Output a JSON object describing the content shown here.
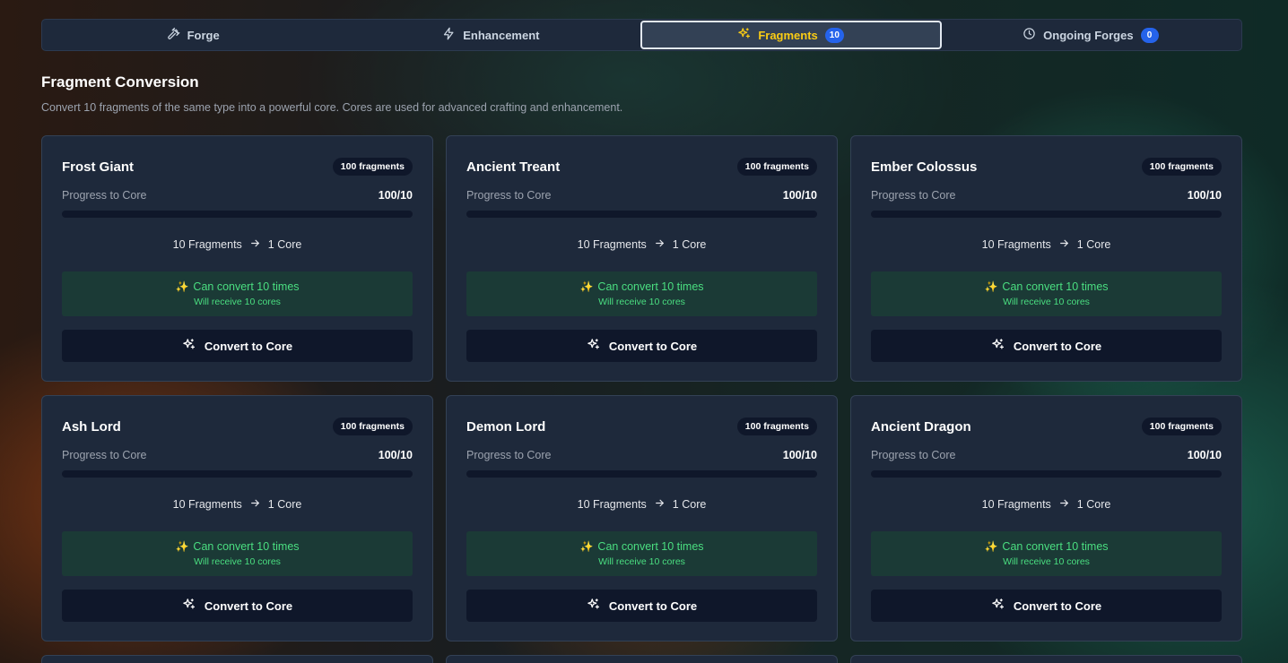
{
  "tabs": [
    {
      "label": "Forge",
      "icon": "hammer-icon",
      "active": false
    },
    {
      "label": "Enhancement",
      "icon": "bolt-icon",
      "active": false
    },
    {
      "label": "Fragments",
      "icon": "sparkles-icon",
      "active": true,
      "badge": "10"
    },
    {
      "label": "Ongoing Forges",
      "icon": "clock-icon",
      "active": false,
      "badge": "0"
    }
  ],
  "section": {
    "title": "Fragment Conversion",
    "description": "Convert 10 fragments of the same type into a powerful core. Cores are used for advanced crafting and enhancement."
  },
  "colors": {
    "accent": "#facc15",
    "badge_blue": "#2563eb",
    "success": "#4ade80",
    "card_bg": "#1e293b"
  },
  "cards": [
    {
      "name": "Frost Giant",
      "badge": "100 fragments",
      "progress_label": "Progress to Core",
      "progress_value": "100/10",
      "recipe_from": "10 Fragments",
      "recipe_to": "1 Core",
      "convert_text": "Can convert 10 times",
      "receive_text": "Will receive 10 cores",
      "button": "Convert to Core"
    },
    {
      "name": "Ancient Treant",
      "badge": "100 fragments",
      "progress_label": "Progress to Core",
      "progress_value": "100/10",
      "recipe_from": "10 Fragments",
      "recipe_to": "1 Core",
      "convert_text": "Can convert 10 times",
      "receive_text": "Will receive 10 cores",
      "button": "Convert to Core"
    },
    {
      "name": "Ember Colossus",
      "badge": "100 fragments",
      "progress_label": "Progress to Core",
      "progress_value": "100/10",
      "recipe_from": "10 Fragments",
      "recipe_to": "1 Core",
      "convert_text": "Can convert 10 times",
      "receive_text": "Will receive 10 cores",
      "button": "Convert to Core"
    },
    {
      "name": "Ash Lord",
      "badge": "100 fragments",
      "progress_label": "Progress to Core",
      "progress_value": "100/10",
      "recipe_from": "10 Fragments",
      "recipe_to": "1 Core",
      "convert_text": "Can convert 10 times",
      "receive_text": "Will receive 10 cores",
      "button": "Convert to Core"
    },
    {
      "name": "Demon Lord",
      "badge": "100 fragments",
      "progress_label": "Progress to Core",
      "progress_value": "100/10",
      "recipe_from": "10 Fragments",
      "recipe_to": "1 Core",
      "convert_text": "Can convert 10 times",
      "receive_text": "Will receive 10 cores",
      "button": "Convert to Core"
    },
    {
      "name": "Ancient Dragon",
      "badge": "100 fragments",
      "progress_label": "Progress to Core",
      "progress_value": "100/10",
      "recipe_from": "10 Fragments",
      "recipe_to": "1 Core",
      "convert_text": "Can convert 10 times",
      "receive_text": "Will receive 10 cores",
      "button": "Convert to Core"
    }
  ]
}
